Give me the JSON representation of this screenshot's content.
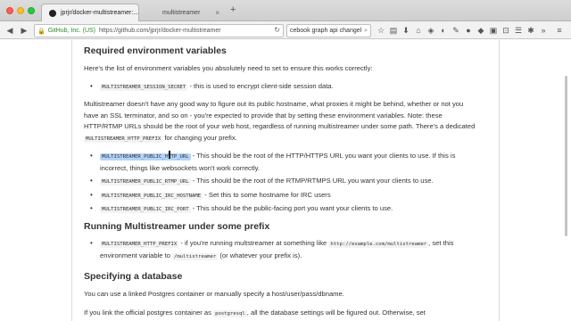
{
  "tabs": [
    {
      "label": "jprjr/docker-multistreamer:...",
      "active": true
    },
    {
      "label": "multistreamer",
      "active": false
    }
  ],
  "navbar": {
    "identity": "GitHub, Inc. (US)",
    "url": "https://github.com/jprjr/docker-multistreamer",
    "search_value": "cebook graph api changel"
  },
  "icons": {
    "back": "back-arrow-icon",
    "forward": "forward-arrow-icon",
    "reload": "reload-icon",
    "star": "bookmark-star-icon",
    "library": "library-icon",
    "download": "download-icon",
    "home": "home-icon",
    "pocket": "pocket-icon",
    "menu": "hamburger-menu-icon"
  },
  "content": {
    "h_env": "Required environment variables",
    "p_env_intro": "Here's the list of environment variables you absolutely need to set to ensure this works correctly:",
    "env_secret_code": "MULTISTREAMER_SESSION_SECRET",
    "env_secret_text": " - this is used to encrypt client-side session data.",
    "p_hostname_1": "Multistreamer doesn't have any good way to figure out its public hostname, what proxies it might be behind, whether or not you have an SSL terminator, and so on - you're expected to provide that by setting these environment variables. Note: these HTTP/RTMP URLs should be the root of your web host, regardless of running multistreamer under some path. There's a dedicated ",
    "p_hostname_code": "MULTISTREAMER_HTTP_PREFIX",
    "p_hostname_2": " for changing your prefix.",
    "env_items": [
      {
        "code": "MULTISTREAMER_PUBLIC_HTTP_URL",
        "text": " - This should be the root of the HTTP/HTTPS URL you want your clients to use. If this is incorrect, things like websockets won't work correctly."
      },
      {
        "code": "MULTISTREAMER_PUBLIC_RTMP_URL",
        "text": " - This should be the root of the RTMP/RTMPS URL you want your clients to use."
      },
      {
        "code": "MULTISTREAMER_PUBLIC_IRC_HOSTNAME",
        "text": " - Set this to some hostname for IRC users"
      },
      {
        "code": "MULTISTREAMER_PUBLIC_IRC_PORT",
        "text": " - This should be the public-facing port you want your clients to use."
      }
    ],
    "h_prefix": "Running Multistreamer under some prefix",
    "prefix_code": "MULTISTREAMER_HTTP_PREFIX",
    "prefix_text_1": " - if you're running multstreamer at something like ",
    "prefix_url_code": "http://example.com/multistreamer",
    "prefix_text_2": ", set this environment variable to ",
    "prefix_path_code": "/multistreamer",
    "prefix_text_3": " (or whatever your prefix is).",
    "h_db": "Specifying a database",
    "p_db": "You can use a linked Postgres container or manually specify a host/user/pass/dbname.",
    "p_link_1": "If you link the official postgres container as ",
    "p_link_code": "postgresql",
    "p_link_2": ", all the database settings will be figured out. Otherwise, set"
  }
}
